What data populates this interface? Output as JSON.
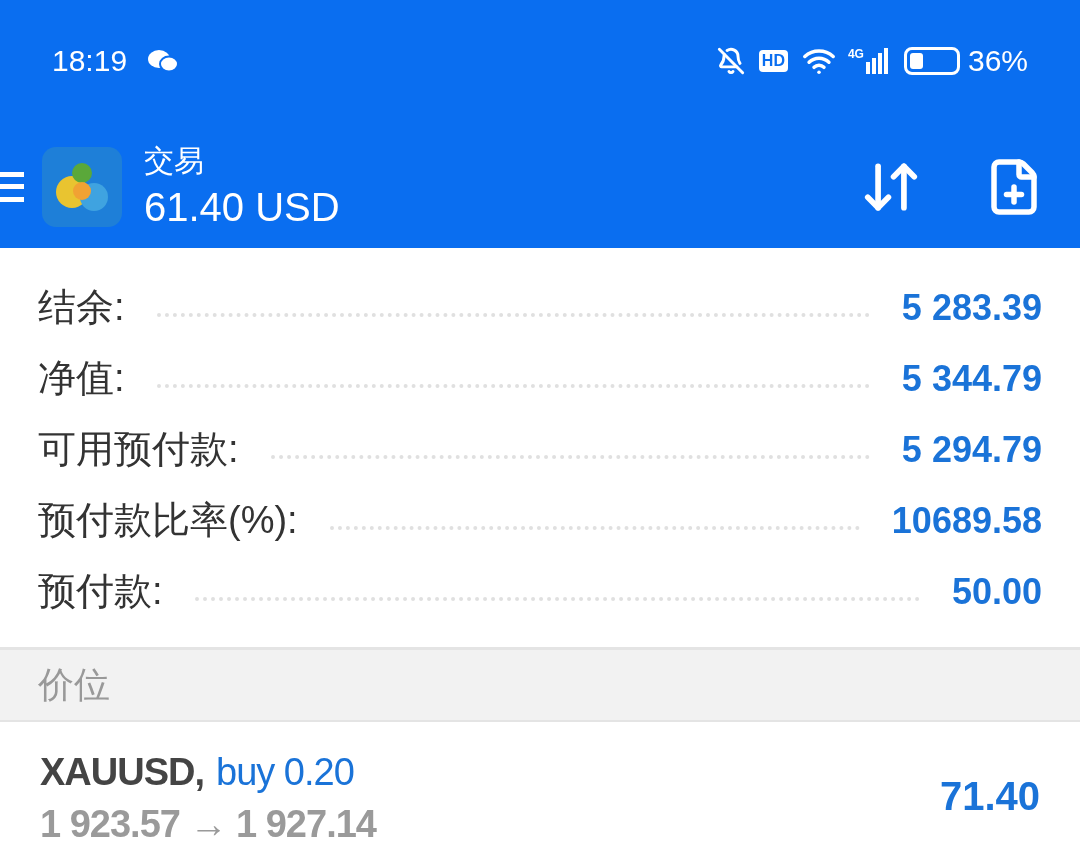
{
  "status_bar": {
    "time": "18:19",
    "hd_badge": "HD",
    "network": "4G",
    "battery": "36%"
  },
  "header": {
    "title": "交易",
    "balance": "61.40 USD"
  },
  "summary": [
    {
      "label": "结余:",
      "value": "5 283.39"
    },
    {
      "label": "净值:",
      "value": "5 344.79"
    },
    {
      "label": "可用预付款:",
      "value": "5 294.79"
    },
    {
      "label": "预付款比率(%):",
      "value": "10689.58"
    },
    {
      "label": "预付款:",
      "value": "50.00"
    }
  ],
  "section": {
    "title": "价位"
  },
  "positions": [
    {
      "symbol": "XAUUSD,",
      "side": "buy 0.20",
      "prices": "1 923.57 → 1 927.14",
      "profit": "71.40"
    }
  ]
}
